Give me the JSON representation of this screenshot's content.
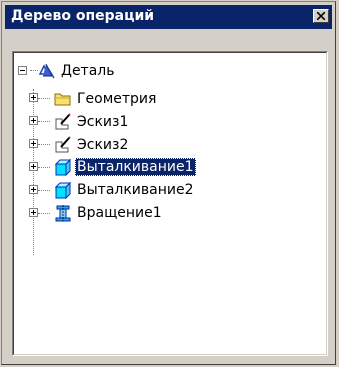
{
  "panel": {
    "title": "Дерево операций"
  },
  "tree": {
    "root": {
      "label": "Деталь",
      "icon": "part-icon",
      "expanded": true
    },
    "children": [
      {
        "label": "Геометрия",
        "icon": "folder-icon",
        "selected": false
      },
      {
        "label": "Эскиз1",
        "icon": "sketch-icon",
        "selected": false
      },
      {
        "label": "Эскиз2",
        "icon": "sketch-icon",
        "selected": false
      },
      {
        "label": "Выталкивание1",
        "icon": "extrude-icon",
        "selected": true
      },
      {
        "label": "Выталкивание2",
        "icon": "extrude-icon",
        "selected": false
      },
      {
        "label": "Вращение1",
        "icon": "revolve-icon",
        "selected": false
      }
    ]
  },
  "colors": {
    "titlebar": "#0a246a",
    "selection": "#0a246a",
    "face": "#d4d0c8"
  }
}
